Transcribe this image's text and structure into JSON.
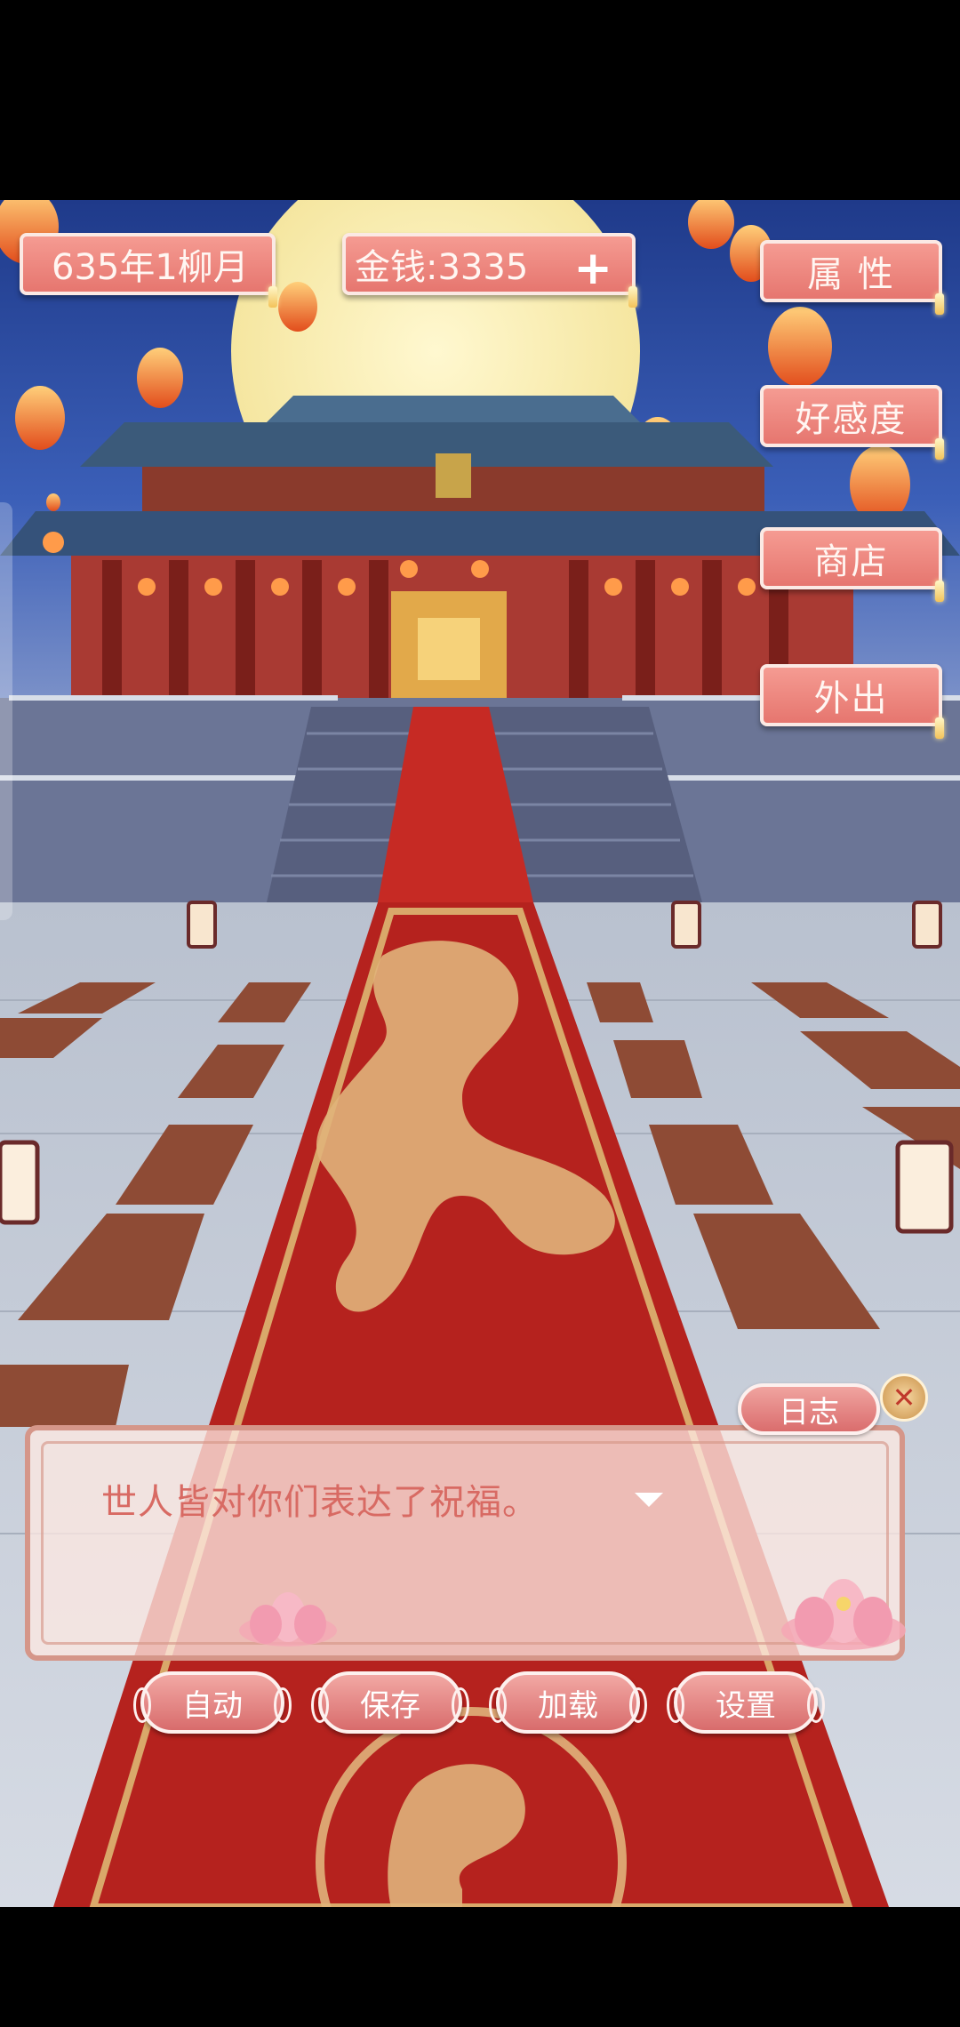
{
  "hud": {
    "date": "635年1柳月",
    "money": "金钱:3335",
    "money_add": "+"
  },
  "menu": {
    "attributes": "属 性",
    "favor": "好感度",
    "shop": "商店",
    "outing": "外出"
  },
  "dialog": {
    "text": "世人皆对你们表达了祝福。",
    "log": "日志",
    "close": "✕"
  },
  "controls": {
    "auto": "自动",
    "save": "保存",
    "load": "加载",
    "settings": "设置"
  },
  "colors": {
    "pill": "#e6766f",
    "carpet": "#b5221e",
    "gold": "#d9a86a"
  }
}
